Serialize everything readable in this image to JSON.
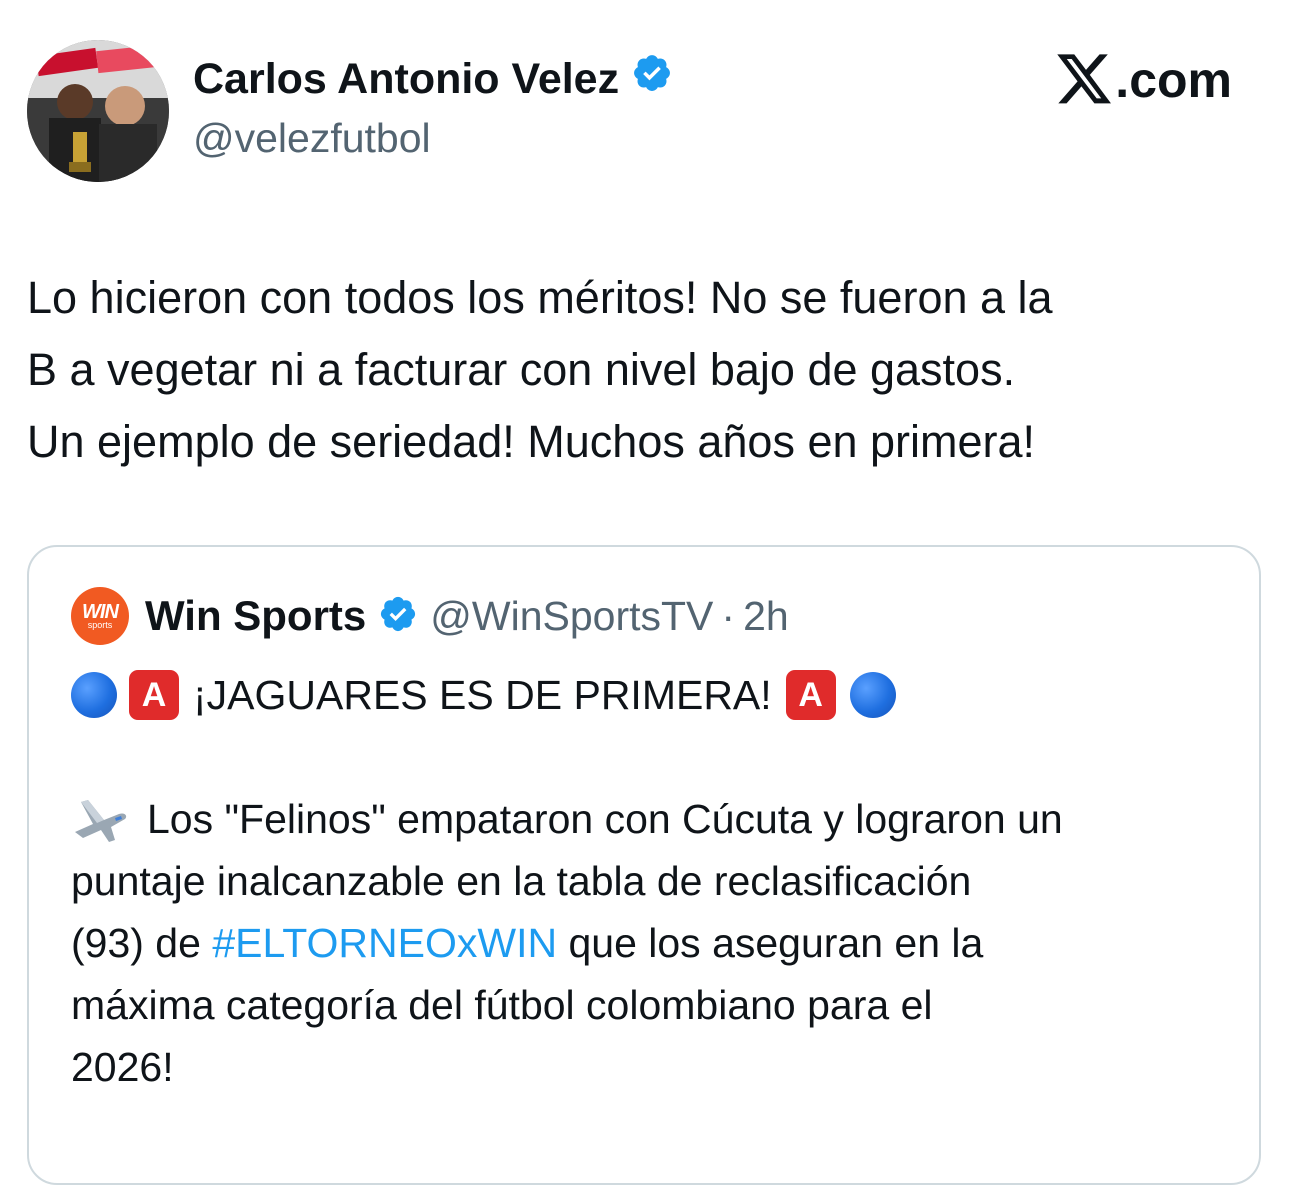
{
  "author": {
    "name": "Carlos Antonio Velez",
    "handle": "@velezfutbol",
    "verified": true
  },
  "brand": {
    "label": ".com",
    "icon": "x-logo-icon"
  },
  "tweet": {
    "lines": [
      "Lo hicieron con todos los méritos! No se fueron a la",
      "B a vegetar ni a facturar con nivel bajo de gastos.",
      "Un ejemplo de seriedad! Muchos años en primera!"
    ]
  },
  "quote": {
    "avatar_text": "WIN",
    "avatar_subtext": "sports",
    "name": "Win Sports",
    "handle": "@WinSportsTV",
    "separator": "·",
    "time": "2h",
    "headline": "¡JAGUARES ES DE PRIMERA!",
    "emoji_letter": "A",
    "body_line1": "Los \"Felinos\" empataron con Cúcuta y lograron un",
    "body_line2": "puntaje inalcanzable en la tabla de reclasificación",
    "body_line3_pre": "(93) de ",
    "hashtag": "#ELTORNEOxWIN",
    "body_line3_post": " que los aseguran en la",
    "body_line4": "máxima categoría del fútbol colombiano para el",
    "body_line5": "2026!"
  },
  "colors": {
    "verified_blue": "#1d9bf0",
    "link_blue": "#1d9bf0",
    "secondary_text": "#536471",
    "border": "#cfd9de",
    "win_orange": "#f15a22"
  }
}
